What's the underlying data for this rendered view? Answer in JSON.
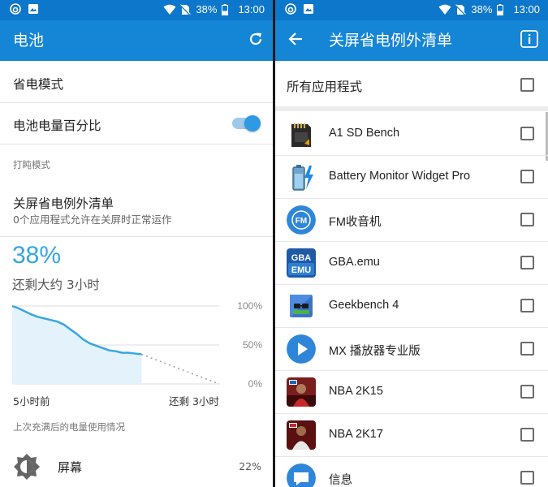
{
  "status_bar": {
    "battery": "38%",
    "time": "13:00"
  },
  "left": {
    "title": "电池",
    "items": {
      "saver": "省电模式",
      "percentage": "电池电量百分比",
      "section": "打盹模式",
      "exceptions_title": "关屏省电例外清单",
      "exceptions_sub": "0个应用程式允许在关屏时正常运作"
    },
    "percent": "38%",
    "remaining": "还剩大约 3小时",
    "chart_data": {
      "type": "area",
      "y_ticks": [
        "100%",
        "50%",
        "0%"
      ],
      "x_labels": [
        "5小时前",
        "还剩 3小时"
      ],
      "ylim": [
        0,
        100
      ],
      "x": [
        0,
        0.25,
        0.5,
        0.75,
        1,
        1.25,
        1.5,
        1.75,
        2,
        2.25,
        2.5,
        2.75,
        3,
        3.25,
        3.5,
        3.75,
        4,
        4.25,
        4.5,
        4.75,
        5
      ],
      "values": [
        100,
        97,
        93,
        89,
        86,
        84,
        82,
        80,
        76,
        70,
        64,
        57,
        52,
        49,
        46,
        43,
        42,
        40,
        40,
        39,
        38
      ],
      "projected": {
        "x": [
          5,
          8
        ],
        "values": [
          38,
          0
        ]
      }
    },
    "usage_label": "上次充满后的电量使用情况",
    "usage": [
      {
        "name": "屏幕",
        "percent": "22%",
        "icon": "brightness-icon"
      }
    ]
  },
  "right": {
    "title": "关屏省电例外清单",
    "all_apps": "所有应用程式",
    "apps": [
      {
        "name": "A1 SD Bench",
        "icon": "sd-card-icon"
      },
      {
        "name": "Battery Monitor Widget Pro",
        "icon": "battery-monitor-icon"
      },
      {
        "name": "FM收音机",
        "icon": "fm-radio-icon"
      },
      {
        "name": "GBA.emu",
        "icon": "gba-emu-icon"
      },
      {
        "name": "Geekbench 4",
        "icon": "geekbench-icon"
      },
      {
        "name": "MX 播放器专业版",
        "icon": "mx-player-icon"
      },
      {
        "name": "NBA 2K15",
        "icon": "nba2k15-icon"
      },
      {
        "name": "NBA 2K17",
        "icon": "nba2k17-icon"
      },
      {
        "name": "信息",
        "icon": "messages-icon"
      }
    ],
    "gba_text": [
      "GBA",
      "EMU"
    ],
    "fm_text": "FM"
  }
}
